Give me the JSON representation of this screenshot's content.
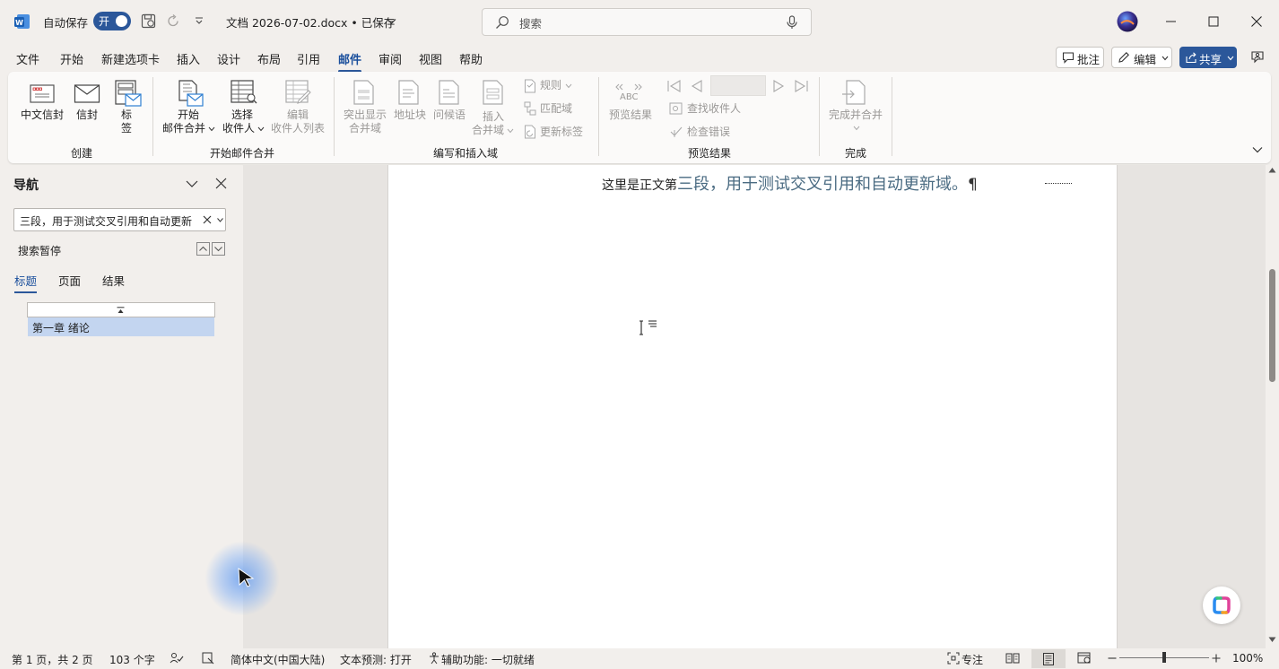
{
  "titlebar": {
    "autosave_label": "自动保存",
    "autosave_state": "开",
    "doc_title": "文档 2026-07-02.docx • 已保存",
    "search_placeholder": "搜索"
  },
  "menu": {
    "tabs": [
      "文件",
      "开始",
      "新建选项卡",
      "插入",
      "设计",
      "布局",
      "引用",
      "邮件",
      "审阅",
      "视图",
      "帮助"
    ],
    "active": "邮件",
    "comment_btn": "批注",
    "edit_btn": "编辑",
    "share_btn": "共享"
  },
  "ribbon": {
    "create": {
      "group": "创建",
      "chinese_envelope": "中文信封",
      "envelope": "信封",
      "labels": "标\n签"
    },
    "start_merge": {
      "group": "开始邮件合并",
      "start": "开始",
      "start2": "邮件合并",
      "select": "选择",
      "select2": "收件人",
      "edit": "编辑",
      "edit2": "收件人列表"
    },
    "write_insert": {
      "group": "编写和插入域",
      "highlight": "突出显示",
      "highlight2": "合并域",
      "address": "地址块",
      "greeting": "问候语",
      "insert": "插入",
      "insert2": "合并域",
      "rules": "规则",
      "match": "匹配域",
      "update": "更新标签"
    },
    "preview": {
      "group": "预览结果",
      "preview_btn": "预览结果",
      "find": "查找收件人",
      "check": "检查错误",
      "abc": "ABC"
    },
    "finish": {
      "group": "完成",
      "finish_btn": "完成并合并"
    }
  },
  "nav": {
    "title": "导航",
    "search_value": "三段，用于测试交叉引用和自动更新",
    "status": "搜索暂停",
    "tabs": [
      "标题",
      "页面",
      "结果"
    ],
    "heading_item": "第一章 绪论"
  },
  "document": {
    "prefix": "这里是正文第",
    "highlight": "三段，用于测试交叉引用和自动更新域。",
    "pilcrow": "¶"
  },
  "status": {
    "page": "第 1 页，共 2 页",
    "words": "103 个字",
    "language": "简体中文(中国大陆)",
    "prediction": "文本预测: 打开",
    "accessibility": "辅助功能: 一切就绪",
    "focus": "专注",
    "zoom": "100%"
  },
  "colors": {
    "accent": "#2b579a",
    "doc_link": "#4a6b82"
  }
}
